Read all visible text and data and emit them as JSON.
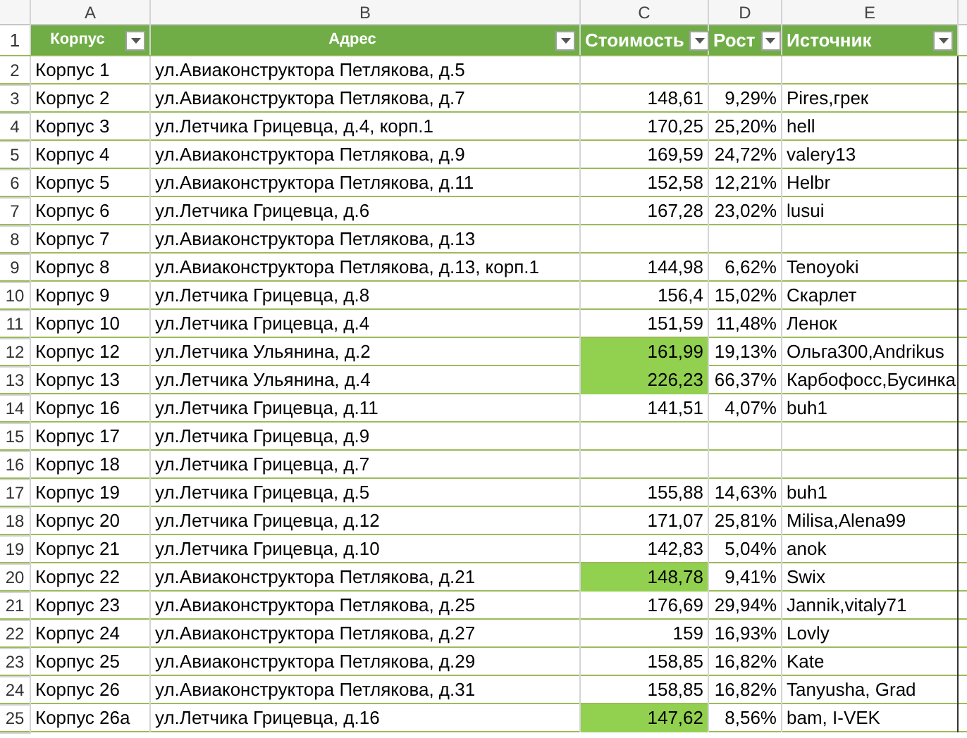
{
  "column_letters": [
    "A",
    "B",
    "C",
    "D",
    "E"
  ],
  "header_row": {
    "number": "1",
    "columns": [
      {
        "label": "Корпус",
        "kind": "small"
      },
      {
        "label": "Адрес",
        "kind": "small"
      },
      {
        "label": "Стоимость",
        "kind": "large"
      },
      {
        "label": "Рост",
        "kind": "large"
      },
      {
        "label": "Источник",
        "kind": "large"
      }
    ]
  },
  "rows": [
    {
      "number": "2",
      "building": "Корпус 1",
      "address": "ул.Авиаконструктора Петлякова, д.5"
    },
    {
      "number": "3",
      "building": "Корпус 2",
      "address": "ул.Авиаконструктора Петлякова, д.7",
      "cost": "148,61",
      "growth": "9,29%",
      "source": "Pires,грек",
      "highlight": false
    },
    {
      "number": "4",
      "building": "Корпус 3",
      "address": "ул.Летчика Грицевца, д.4, корп.1",
      "cost": "170,25",
      "growth": "25,20%",
      "source": "hell",
      "highlight": false
    },
    {
      "number": "5",
      "building": "Корпус 4",
      "address": "ул.Авиаконструктора Петлякова, д.9",
      "cost": "169,59",
      "growth": "24,72%",
      "source": "valery13",
      "highlight": false
    },
    {
      "number": "6",
      "building": "Корпус 5",
      "address": "ул.Авиаконструктора Петлякова, д.11",
      "cost": "152,58",
      "growth": "12,21%",
      "source": "Helbr",
      "highlight": false
    },
    {
      "number": "7",
      "building": "Корпус 6",
      "address": "ул.Летчика Грицевца, д.6",
      "cost": "167,28",
      "growth": "23,02%",
      "source": "lusui",
      "highlight": false
    },
    {
      "number": "8",
      "building": "Корпус 7",
      "address": "ул.Авиаконструктора Петлякова, д.13"
    },
    {
      "number": "9",
      "building": "Корпус 8",
      "address": "ул.Авиаконструктора Петлякова, д.13, корп.1",
      "cost": "144,98",
      "growth": "6,62%",
      "source": "Tenoyoki",
      "highlight": false
    },
    {
      "number": "10",
      "building": "Корпус 9",
      "address": "ул.Летчика Грицевца, д.8",
      "cost": "156,4",
      "growth": "15,02%",
      "source": "Скарлет",
      "highlight": false
    },
    {
      "number": "11",
      "building": "Корпус 10",
      "address": "ул.Летчика Грицевца, д.4",
      "cost": "151,59",
      "growth": "11,48%",
      "source": "Ленок",
      "highlight": false
    },
    {
      "number": "12",
      "building": "Корпус 12",
      "address": "ул.Летчика Ульянина, д.2",
      "cost": "161,99",
      "growth": "19,13%",
      "source": "Ольга300,Andrikus",
      "highlight": true
    },
    {
      "number": "13",
      "building": "Корпус 13",
      "address": "ул.Летчика Ульянина, д.4",
      "cost": "226,23",
      "growth": "66,37%",
      "source": "Карбофосс,Бусинка",
      "highlight": true
    },
    {
      "number": "14",
      "building": "Корпус 16",
      "address": "ул.Летчика Грицевца, д.11",
      "cost": "141,51",
      "growth": "4,07%",
      "source": "buh1",
      "highlight": false
    },
    {
      "number": "15",
      "building": "Корпус 17",
      "address": "ул.Летчика Грицевца, д.9"
    },
    {
      "number": "16",
      "building": "Корпус 18",
      "address": "ул.Летчика Грицевца, д.7"
    },
    {
      "number": "17",
      "building": "Корпус 19",
      "address": "ул.Летчика Грицевца, д.5",
      "cost": "155,88",
      "growth": "14,63%",
      "source": "buh1",
      "highlight": false
    },
    {
      "number": "18",
      "building": "Корпус 20",
      "address": "ул.Летчика Грицевца, д.12",
      "cost": "171,07",
      "growth": "25,81%",
      "source": "Milisa,Alena99",
      "highlight": false
    },
    {
      "number": "19",
      "building": "Корпус 21",
      "address": "ул.Летчика Грицевца, д.10",
      "cost": "142,83",
      "growth": "5,04%",
      "source": "anok",
      "highlight": false
    },
    {
      "number": "20",
      "building": "Корпус 22",
      "address": "ул.Авиаконструктора Петлякова, д.21",
      "cost": "148,78",
      "growth": "9,41%",
      "source": "Swix",
      "highlight": true
    },
    {
      "number": "21",
      "building": "Корпус 23",
      "address": "ул.Авиаконструктора Петлякова, д.25",
      "cost": "176,69",
      "growth": "29,94%",
      "source": "Jannik,vitaly71",
      "highlight": false
    },
    {
      "number": "22",
      "building": "Корпус 24",
      "address": "ул.Авиаконструктора Петлякова, д.27",
      "cost": "159",
      "growth": "16,93%",
      "source": "Lovly",
      "highlight": false
    },
    {
      "number": "23",
      "building": "Корпус 25",
      "address": "ул.Авиаконструктора Петлякова, д.29",
      "cost": "158,85",
      "growth": "16,82%",
      "source": "Kate",
      "highlight": false
    },
    {
      "number": "24",
      "building": "Корпус 26",
      "address": "ул.Авиаконструктора Петлякова, д.31",
      "cost": "158,85",
      "growth": "16,82%",
      "source": "Tanyusha, Grad",
      "highlight": false
    },
    {
      "number": "25",
      "building": "Корпус 26а",
      "address": "ул.Летчика Грицевца, д.16",
      "cost": "147,62",
      "growth": "8,56%",
      "source": "bam, I-VEK",
      "highlight": true
    }
  ]
}
